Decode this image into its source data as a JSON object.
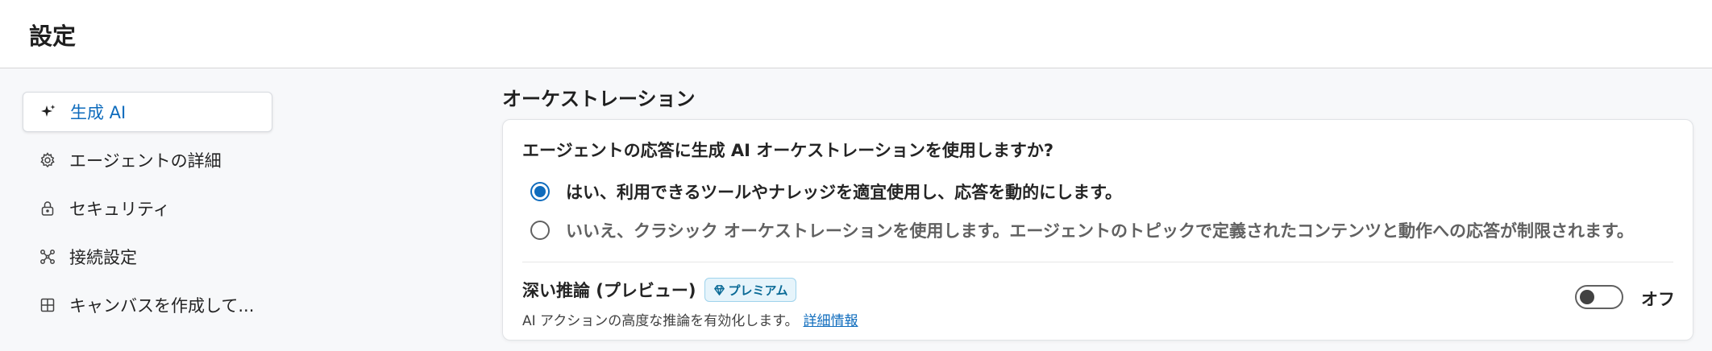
{
  "header": {
    "title": "設定"
  },
  "sidebar": {
    "items": [
      {
        "label": "生成 AI",
        "icon": "sparkle-icon",
        "active": true
      },
      {
        "label": "エージェントの詳細",
        "icon": "gear-icon"
      },
      {
        "label": "セキュリティ",
        "icon": "lock-icon"
      },
      {
        "label": "接続設定",
        "icon": "connection-icon"
      },
      {
        "label": "キャンバスを作成して...",
        "icon": "grid-icon"
      }
    ]
  },
  "main": {
    "section_title": "オーケストレーション",
    "question": "エージェントの応答に生成 AI オーケストレーションを使用しますか?",
    "options": [
      {
        "label": "はい、利用できるツールやナレッジを適宜使用し、応答を動的にします。",
        "selected": true
      },
      {
        "label": "いいえ、クラシック オーケストレーションを使用します。エージェントのトピックで定義されたコンテンツと動作への応答が制限されます。",
        "selected": false
      }
    ],
    "deep_reasoning": {
      "title": "深い推論 (プレビュー)",
      "badge": "プレミアム",
      "description": "AI アクションの高度な推論を有効化します。",
      "link": "詳細情報",
      "toggle_label": "オフ",
      "enabled": false
    }
  },
  "colors": {
    "accent": "#0f6cbd",
    "badge_bg": "#e6f4fb",
    "badge_text": "#0a6a96"
  }
}
